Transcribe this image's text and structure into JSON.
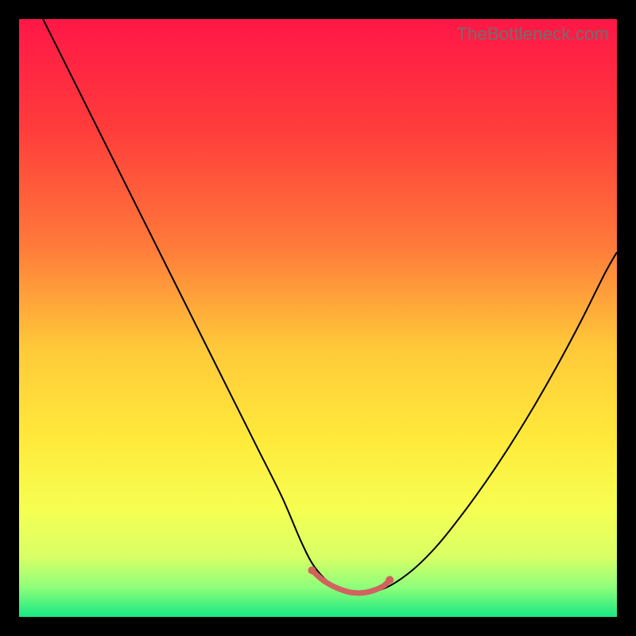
{
  "watermark": "TheBottleneck.com",
  "chart_data": {
    "type": "line",
    "title": "",
    "xlabel": "",
    "ylabel": "",
    "xlim": [
      0,
      100
    ],
    "ylim": [
      0,
      100
    ],
    "gradient_stops": [
      {
        "offset": 0,
        "color": "#ff1747"
      },
      {
        "offset": 18,
        "color": "#ff3b3b"
      },
      {
        "offset": 38,
        "color": "#ff7a3a"
      },
      {
        "offset": 55,
        "color": "#ffc93a"
      },
      {
        "offset": 70,
        "color": "#ffe93a"
      },
      {
        "offset": 82,
        "color": "#f6ff52"
      },
      {
        "offset": 90,
        "color": "#d8ff66"
      },
      {
        "offset": 95,
        "color": "#8fff7a"
      },
      {
        "offset": 100,
        "color": "#17e884"
      }
    ],
    "series": [
      {
        "name": "curve",
        "color": "#000000",
        "x": [
          4,
          8,
          12,
          16,
          20,
          24,
          28,
          32,
          36,
          40,
          44,
          47,
          49,
          51,
          53,
          55,
          57,
          59,
          62,
          66,
          70,
          74,
          78,
          82,
          86,
          90,
          94,
          98,
          100
        ],
        "y": [
          100,
          92,
          84,
          76,
          68,
          60,
          52,
          44,
          36,
          28,
          20,
          13,
          9,
          6.5,
          5,
          4.2,
          4,
          4.2,
          5.2,
          8,
          12,
          17,
          22.5,
          28.5,
          35,
          42,
          49.5,
          57.5,
          61
        ]
      },
      {
        "name": "highlight",
        "color": "#d1625f",
        "x": [
          49,
          50.5,
          52,
          53.5,
          55,
          56.5,
          58,
          59.5,
          61,
          62
        ],
        "y": [
          7.8,
          6.4,
          5.4,
          4.7,
          4.2,
          4.0,
          4.1,
          4.5,
          5.2,
          6.2
        ]
      }
    ],
    "highlight_dot_radius": 5
  }
}
